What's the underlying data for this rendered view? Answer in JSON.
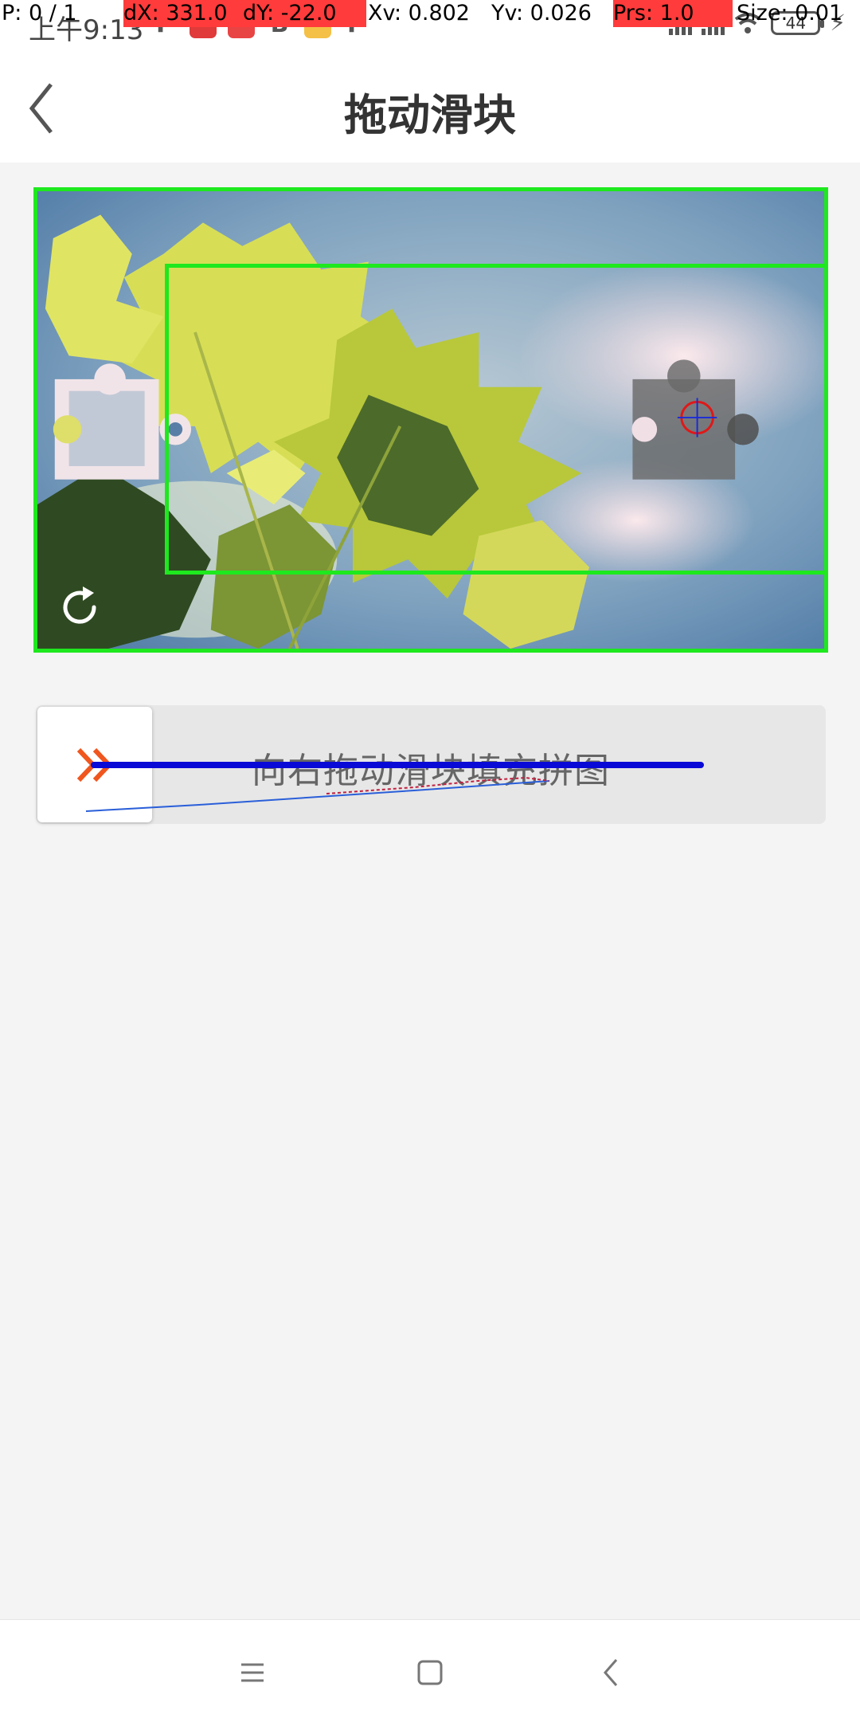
{
  "status_bar": {
    "time": "上午9:13",
    "battery": "44",
    "icons": [
      "p-app-icon",
      "tiktok-icon",
      "red-app-icon",
      "red-app-icon-2",
      "b-app-icon",
      "truck-app-icon",
      "p-app-icon-2"
    ]
  },
  "debug_overlay": {
    "pointer": "P: 0 / 1",
    "dx": "dX: 331.0",
    "dy": "dY: -22.0",
    "xv": "Xv: 0.802",
    "yv": "Yv: 0.026",
    "prs": "Prs: 1.0",
    "size": "Size: 0.01"
  },
  "header": {
    "title": "拖动滑块",
    "back_icon": "chevron-left-icon"
  },
  "puzzle": {
    "refresh_icon": "refresh-icon",
    "outline_color": "#1ee81e"
  },
  "slider": {
    "hint": "向右拖动滑块填充拼图",
    "knob_icon": "double-chevron-right-icon",
    "accent": "#f0561e"
  },
  "navbar": {
    "icons": [
      "menu-icon",
      "home-square-icon",
      "back-icon"
    ]
  }
}
